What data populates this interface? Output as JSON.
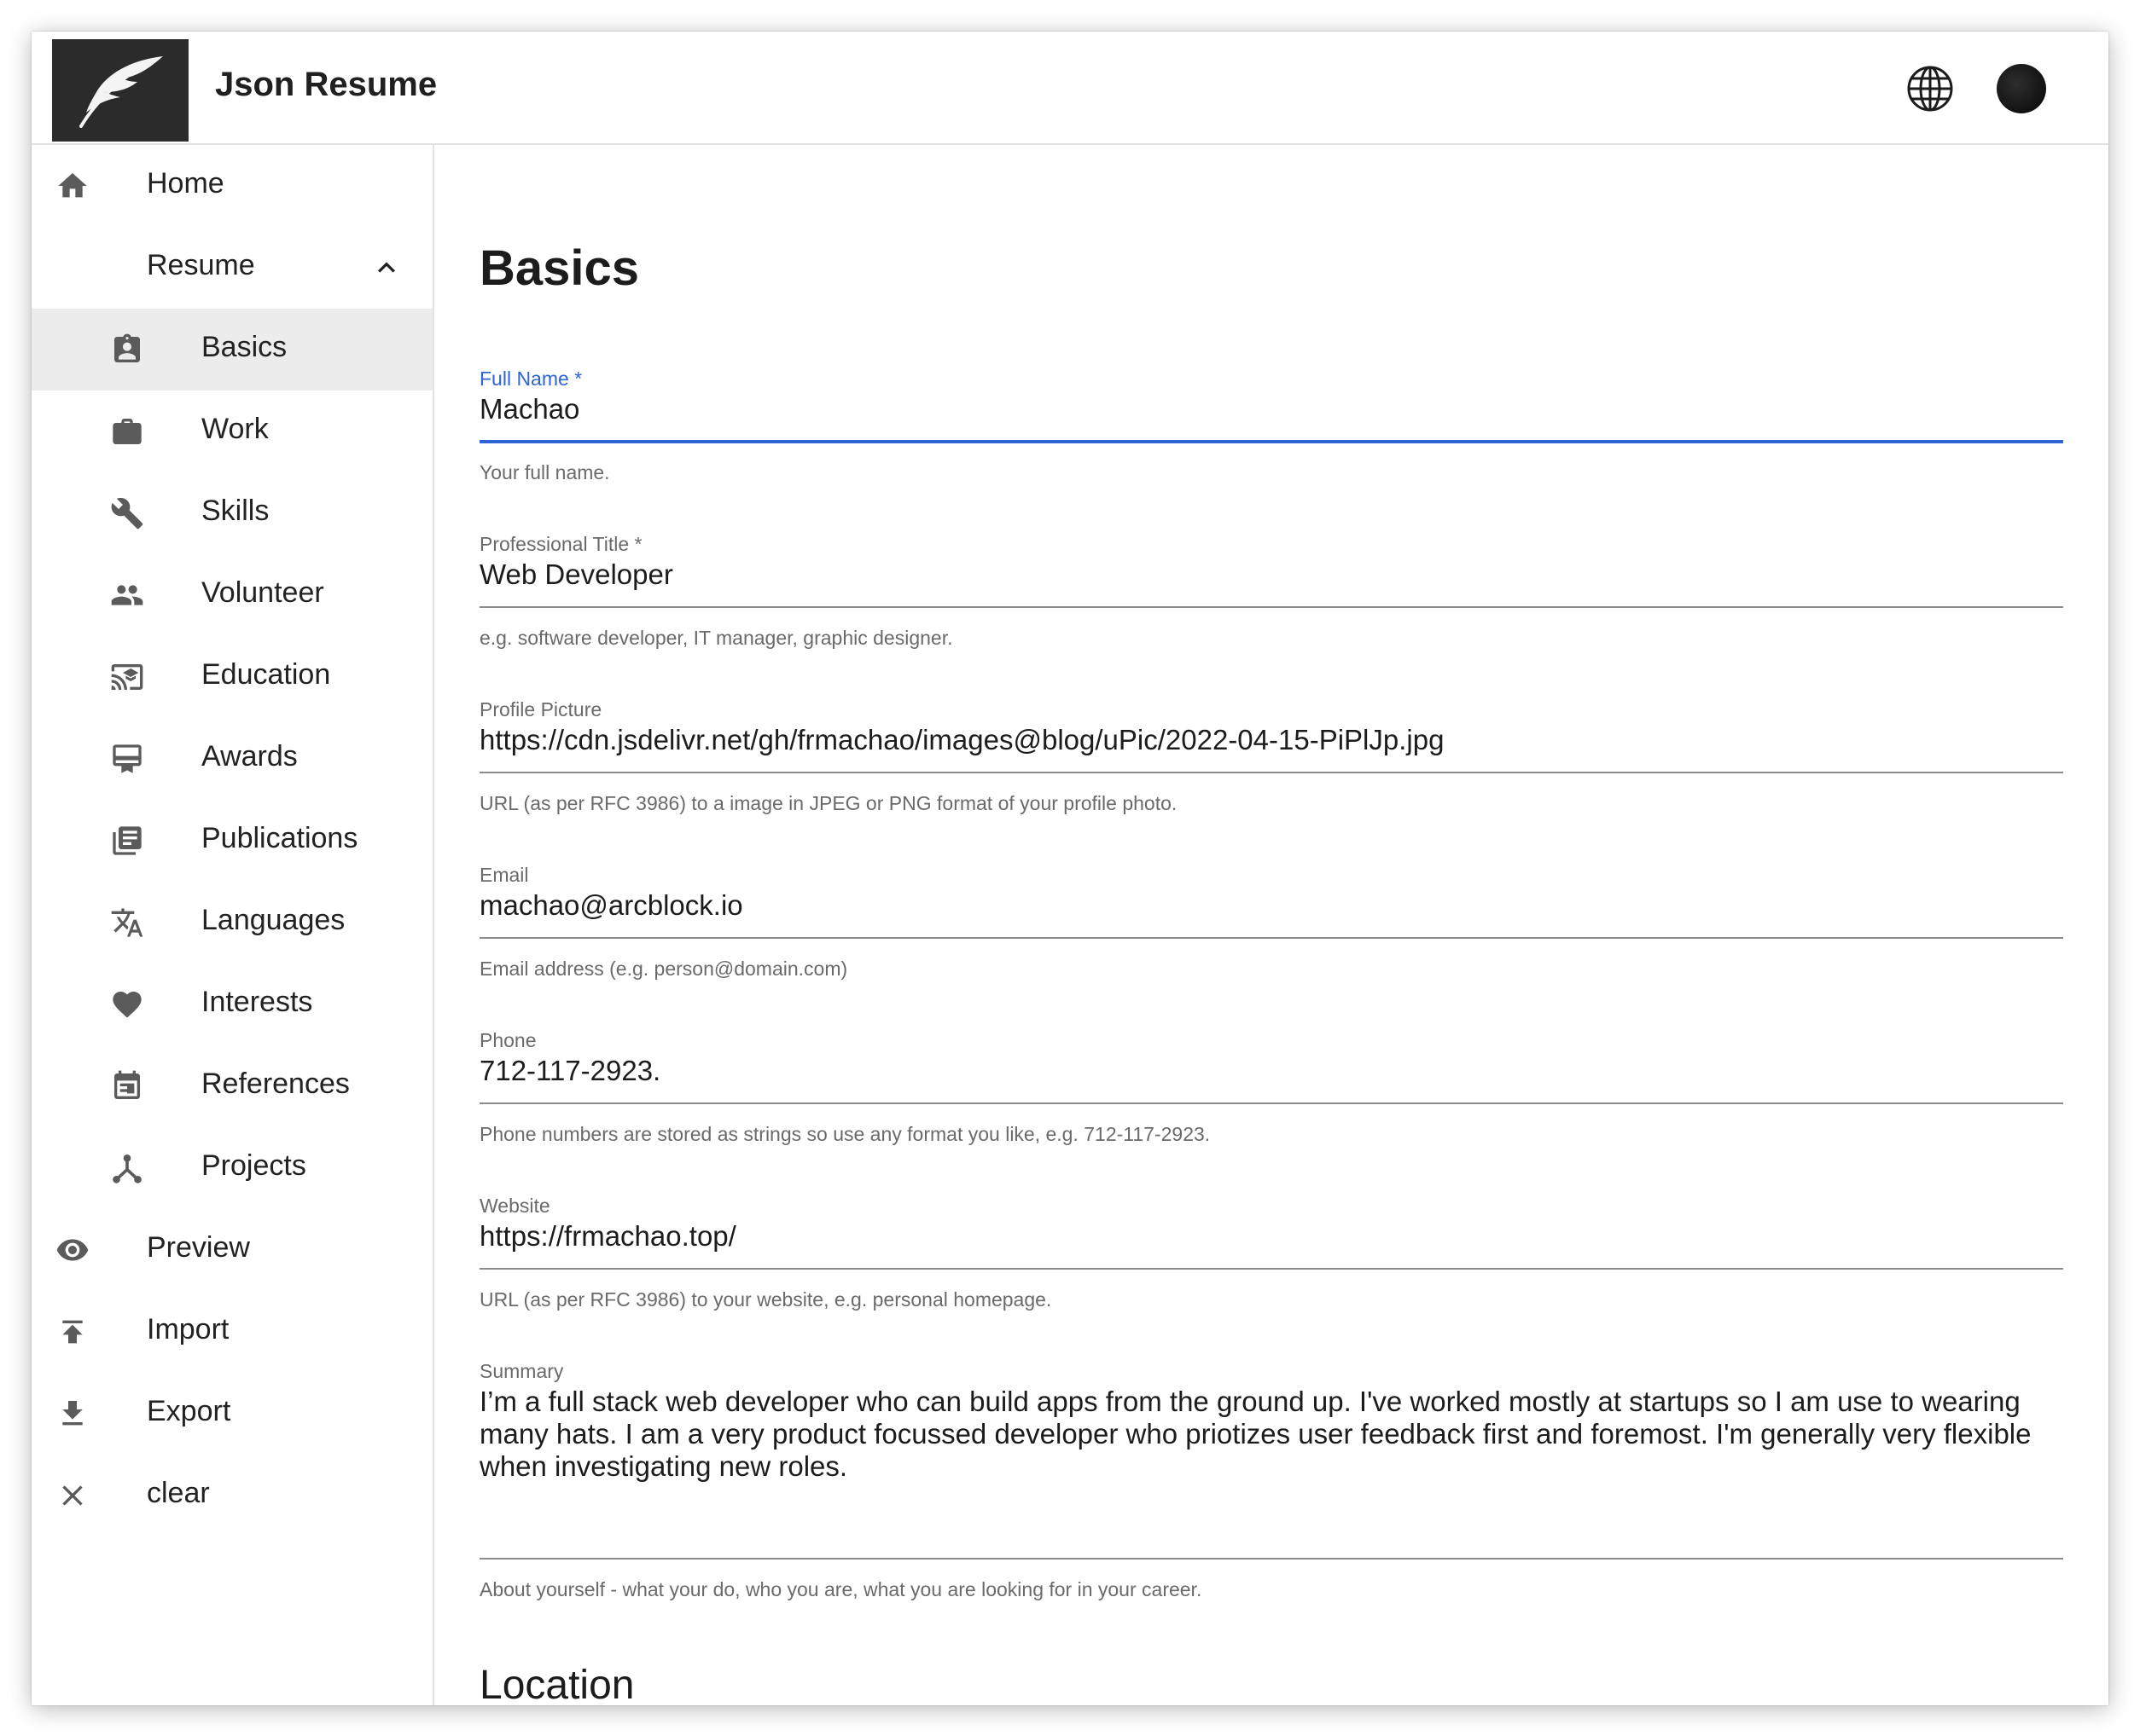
{
  "app": {
    "title": "Json Resume"
  },
  "colors": {
    "accent": "#2f64d6",
    "active_bg": "#ececec",
    "logo_bg": "#2b2b2b"
  },
  "header": {
    "icons": [
      "feather-logo-icon",
      "globe-icon",
      "avatar"
    ]
  },
  "sidebar": {
    "top": [
      {
        "label": "Home",
        "icon": "home-icon"
      },
      {
        "label": "Resume",
        "icon": "none",
        "expanded": true
      }
    ],
    "resume_items": [
      {
        "label": "Basics",
        "icon": "badge-icon",
        "active": true
      },
      {
        "label": "Work",
        "icon": "briefcase-icon"
      },
      {
        "label": "Skills",
        "icon": "wrench-icon"
      },
      {
        "label": "Volunteer",
        "icon": "people-icon"
      },
      {
        "label": "Education",
        "icon": "cast-education-icon"
      },
      {
        "label": "Awards",
        "icon": "card-membership-icon"
      },
      {
        "label": "Publications",
        "icon": "library-books-icon"
      },
      {
        "label": "Languages",
        "icon": "translate-icon"
      },
      {
        "label": "Interests",
        "icon": "heart-icon"
      },
      {
        "label": "References",
        "icon": "calendar-icon"
      },
      {
        "label": "Projects",
        "icon": "fork-icon"
      }
    ],
    "bottom": [
      {
        "label": "Preview",
        "icon": "eye-icon"
      },
      {
        "label": "Import",
        "icon": "upload-icon"
      },
      {
        "label": "Export",
        "icon": "download-icon"
      },
      {
        "label": "clear",
        "icon": "close-icon"
      }
    ]
  },
  "main": {
    "title": "Basics",
    "fields": {
      "full_name": {
        "label": "Full Name *",
        "value": "Machao",
        "help": "Your full name."
      },
      "professional_title": {
        "label": "Professional Title *",
        "value": "Web Developer",
        "help": "e.g. software developer, IT manager, graphic designer."
      },
      "profile_picture": {
        "label": "Profile Picture",
        "value": "https://cdn.jsdelivr.net/gh/frmachao/images@blog/uPic/2022-04-15-PiPlJp.jpg",
        "help": "URL (as per RFC 3986) to a image in JPEG or PNG format of your profile photo."
      },
      "email": {
        "label": "Email",
        "value": "machao@arcblock.io",
        "help": "Email address (e.g. person@domain.com)"
      },
      "phone": {
        "label": "Phone",
        "value": "712-117-2923.",
        "help": "Phone numbers are stored as strings so use any format you like, e.g. 712-117-2923."
      },
      "website": {
        "label": "Website",
        "value": "https://frmachao.top/",
        "help": "URL (as per RFC 3986) to your website, e.g. personal homepage."
      },
      "summary": {
        "label": "Summary",
        "value": "I’m a full stack web developer who can build apps from the ground up. I've worked mostly at startups so I am use to wearing many hats. I am a very product focussed developer who priotizes user feedback first and foremost. I'm generally very flexible when investigating new roles.",
        "help": "About yourself - what your do, who you are, what you are looking for in your career."
      }
    },
    "section_location": "Location"
  }
}
